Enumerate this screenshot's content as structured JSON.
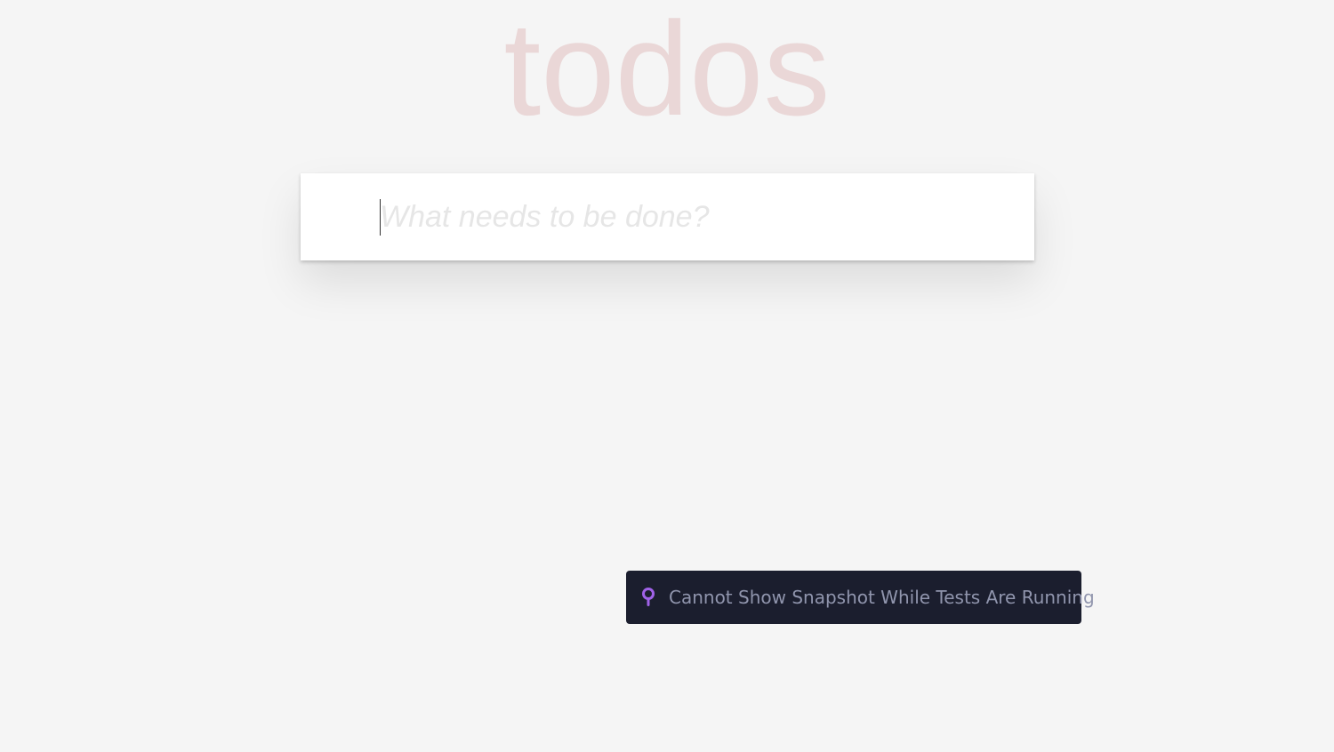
{
  "header": {
    "title": "todos"
  },
  "new_todo": {
    "placeholder": "What needs to be done?",
    "value": ""
  },
  "snapshot_toast": {
    "icon": "pin-icon",
    "message": "Cannot Show Snapshot While Tests Are Running",
    "icon_color": "#a062e8",
    "background": "#1b1e2e"
  },
  "colors": {
    "page_background": "#f5f5f5",
    "title": "rgba(175,47,47,0.15)"
  }
}
